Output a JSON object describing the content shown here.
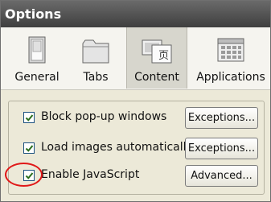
{
  "window": {
    "title": "Options"
  },
  "tabs": [
    {
      "label": "General",
      "selected": false,
      "icon": "general-icon"
    },
    {
      "label": "Tabs",
      "selected": false,
      "icon": "tabs-icon"
    },
    {
      "label": "Content",
      "selected": true,
      "icon": "content-icon"
    },
    {
      "label": "Applications",
      "selected": false,
      "icon": "applications-icon"
    }
  ],
  "content": {
    "rows": [
      {
        "label": "Block pop-up windows",
        "checked": true,
        "button": "Exceptions..."
      },
      {
        "label": "Load images automatically",
        "checked": true,
        "button": "Exceptions..."
      },
      {
        "label": "Enable JavaScript",
        "checked": true,
        "button": "Advanced..."
      }
    ]
  },
  "annotation": {
    "color": "#e01818"
  }
}
